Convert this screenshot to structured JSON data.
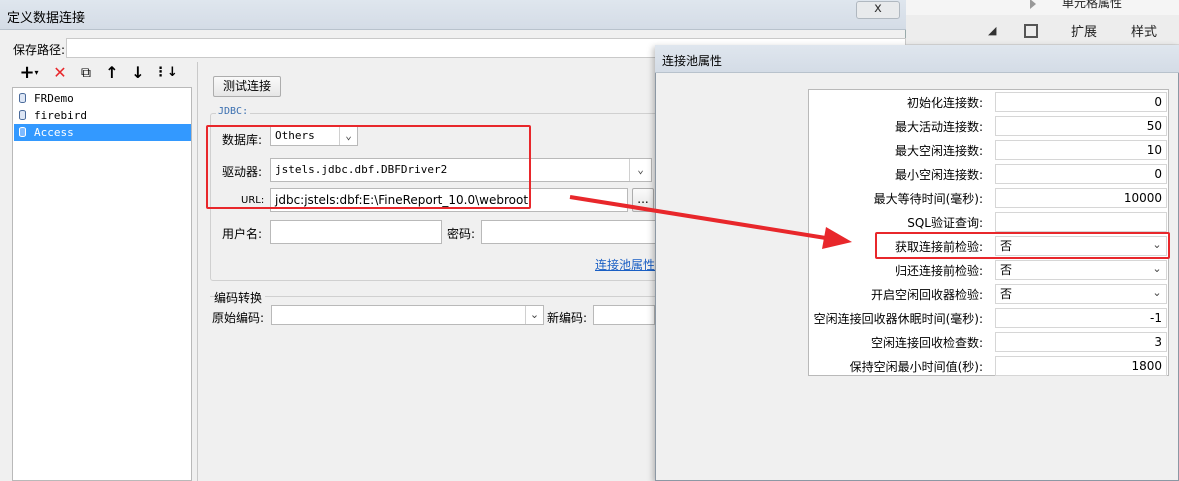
{
  "background": {
    "prop_title": "单元格属性",
    "tabs": [
      "扩展",
      "样式"
    ]
  },
  "dialog": {
    "title": "定义数据连接",
    "close_label": "x",
    "save_path_label": "保存路径:",
    "connections": [
      "FRDemo",
      "firebird",
      "Access"
    ],
    "test_button": "测试连接",
    "jdbc_group": "JDBC:",
    "database_label": "数据库:",
    "database_value": "Others",
    "driver_label": "驱动器:",
    "driver_value": "jstels.jdbc.dbf.DBFDriver2",
    "url_label": "URL:",
    "url_value": "jdbc:jstels:dbf:E:\\FineReport_10.0\\webroot",
    "url_button": "...",
    "username_label": "用户名:",
    "password_label": "密码:",
    "pool_link": "连接池属性",
    "encoding_group": "编码转换",
    "orig_encoding_label": "原始编码:",
    "new_encoding_label": "新编码:"
  },
  "pool": {
    "title": "连接池属性",
    "rows": [
      {
        "label": "初始化连接数:",
        "value": "0"
      },
      {
        "label": "最大活动连接数:",
        "value": "50"
      },
      {
        "label": "最大空闲连接数:",
        "value": "10"
      },
      {
        "label": "最小空闲连接数:",
        "value": "0"
      },
      {
        "label": "最大等待时间(毫秒):",
        "value": "10000"
      },
      {
        "label": "SQL验证查询:",
        "value": ""
      },
      {
        "label": "获取连接前检验:",
        "value": "否"
      },
      {
        "label": "归还连接前检验:",
        "value": "否"
      },
      {
        "label": "开启空闲回收器检验:",
        "value": "否"
      },
      {
        "label": "空闲连接回收器休眠时间(毫秒):",
        "value": "-1"
      },
      {
        "label": "空闲连接回收检查数:",
        "value": "3"
      },
      {
        "label": "保持空闲最小时间值(秒):",
        "value": "1800"
      }
    ]
  },
  "colors": {
    "selection": "#3399ff",
    "annotation_red": "#e8272b",
    "link": "#1a5fc4"
  }
}
